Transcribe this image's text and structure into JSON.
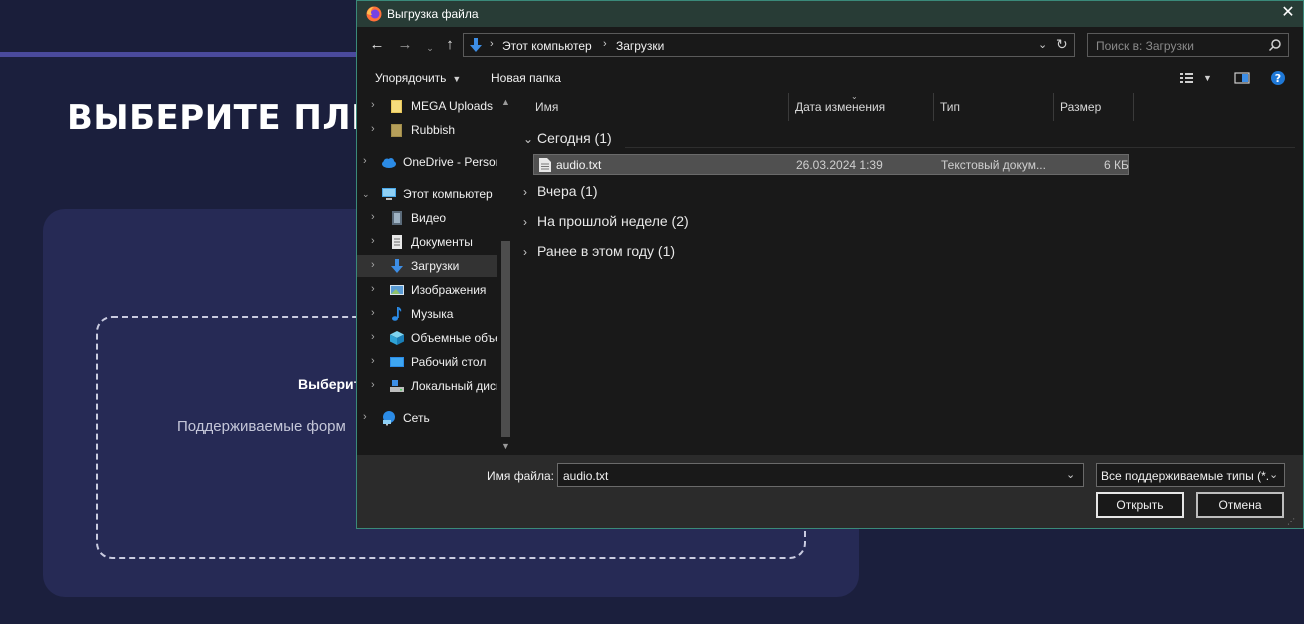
{
  "page": {
    "heading": "ВЫБЕРИТЕ ПЛЕ",
    "drop_title": "Выберит",
    "drop_subtitle": "Поддерживаемые форм"
  },
  "dialog": {
    "title": "Выгрузка файла",
    "close_glyph": "✕",
    "address": {
      "crumbs": [
        "Этот компьютер",
        "Загрузки"
      ],
      "separator": "›"
    },
    "search_placeholder": "Поиск в: Загрузки",
    "toolbar": {
      "organize": "Упорядочить",
      "new_folder": "Новая папка"
    },
    "nav_items": [
      {
        "label": "MEGA Uploads",
        "icon": "folder-icon"
      },
      {
        "label": "Rubbish",
        "icon": "folder-icon"
      },
      {
        "label": "OneDrive - Personal",
        "icon": "cloud-icon"
      },
      {
        "label": "Этот компьютер",
        "icon": "computer-icon"
      },
      {
        "label": "Видео",
        "icon": "video-icon"
      },
      {
        "label": "Документы",
        "icon": "documents-icon"
      },
      {
        "label": "Загрузки",
        "icon": "download-icon"
      },
      {
        "label": "Изображения",
        "icon": "images-icon"
      },
      {
        "label": "Музыка",
        "icon": "music-icon"
      },
      {
        "label": "Объемные объекты",
        "icon": "3d-objects-icon"
      },
      {
        "label": "Рабочий стол",
        "icon": "desktop-icon"
      },
      {
        "label": "Локальный диск",
        "icon": "local-disk-icon"
      },
      {
        "label": "Сеть",
        "icon": "network-icon"
      }
    ],
    "columns": {
      "name": "Имя",
      "date": "Дата изменения",
      "type": "Тип",
      "size": "Размер"
    },
    "groups": {
      "today": "Сегодня (1)",
      "yesterday": "Вчера (1)",
      "last_week": "На прошлой неделе (2)",
      "this_year": "Ранее в этом году (1)"
    },
    "file": {
      "name": "audio.txt",
      "date": "26.03.2024 1:39",
      "type": "Текстовый докум...",
      "size": "6 КБ"
    },
    "filename_label": "Имя файла:",
    "filename_value": "audio.txt",
    "filetype_value": "Все поддерживаемые типы (*.",
    "open_button": "Открыть",
    "cancel_button": "Отмена"
  },
  "colors": {
    "page_bg": "#1b1f3d",
    "card_bg": "#262a55",
    "accent_line": "#4a4a9c",
    "dialog_titlebar": "#283c36",
    "dialog_bg": "#191919",
    "selected_row": "#505050"
  }
}
